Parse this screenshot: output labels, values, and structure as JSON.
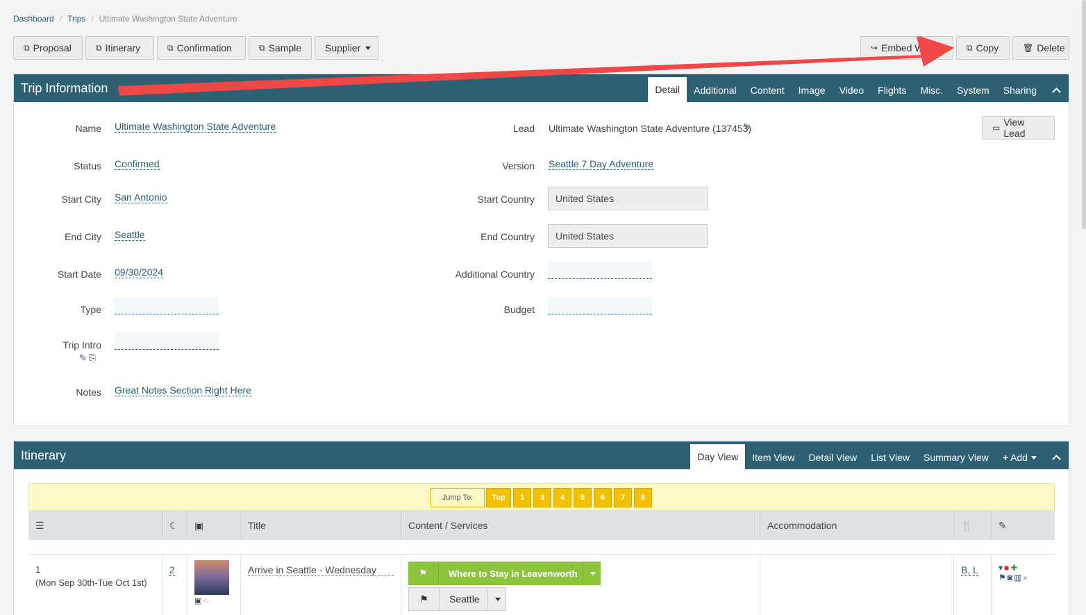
{
  "breadcrumb": {
    "dashboard": "Dashboard",
    "trips": "Trips",
    "current": "Ultimate Washington State Adventure"
  },
  "toolbar": {
    "proposal": "Proposal",
    "itinerary": "Itinerary",
    "confirmation": "Confirmation",
    "sample": "Sample",
    "supplier": "Supplier",
    "embed": "Embed Wi...",
    "copy": "Copy",
    "delete": "Delete"
  },
  "trip": {
    "title": "Trip Information",
    "tabs": [
      "Detail",
      "Additional",
      "Content",
      "Image",
      "Video",
      "Flights",
      "Misc.",
      "System",
      "Sharing"
    ],
    "labels": {
      "name": "Name",
      "status": "Status",
      "start_city": "Start City",
      "end_city": "End City",
      "start_date": "Start Date",
      "type": "Type",
      "trip_intro": "Trip Intro",
      "notes": "Notes",
      "lead": "Lead",
      "version": "Version",
      "start_country": "Start Country",
      "end_country": "End Country",
      "additional_country": "Additional Country",
      "budget": "Budget"
    },
    "values": {
      "name": "Ultimate Washington State Adventure",
      "status": "Confirmed",
      "start_city": "San Antonio",
      "end_city": "Seattle",
      "start_date": "09/30/2024",
      "notes": "Great Notes Section Right Here",
      "lead": "Ultimate Washington State Adventure (137453)",
      "version": "Seattle 7 Day Adventure",
      "start_country": "United States",
      "end_country": "United States"
    },
    "view_lead": "View Lead"
  },
  "itinerary": {
    "title": "Itinerary",
    "tabs": [
      "Day View",
      "Item View",
      "Detail View",
      "List View",
      "Summary View"
    ],
    "add": "Add",
    "jump_label": "Jump To:",
    "jump": [
      "Top",
      "1",
      "3",
      "4",
      "5",
      "6",
      "7",
      "8"
    ],
    "columns": {
      "title": "Title",
      "content": "Content / Services",
      "accommodation": "Accommodation"
    },
    "row": {
      "day": "1",
      "dates": "(Mon Sep 30th-Tue Oct 1st)",
      "nights": "2",
      "title": "Arrive in Seattle - Wednesday",
      "service1": "Where to Stay in Leavenworth",
      "service2": "Seattle",
      "meals": "B, L"
    }
  },
  "colors": {
    "header": "#2d6072",
    "green": "#8cc43c",
    "jump": "#f2c200",
    "arrow": "#f04747"
  }
}
